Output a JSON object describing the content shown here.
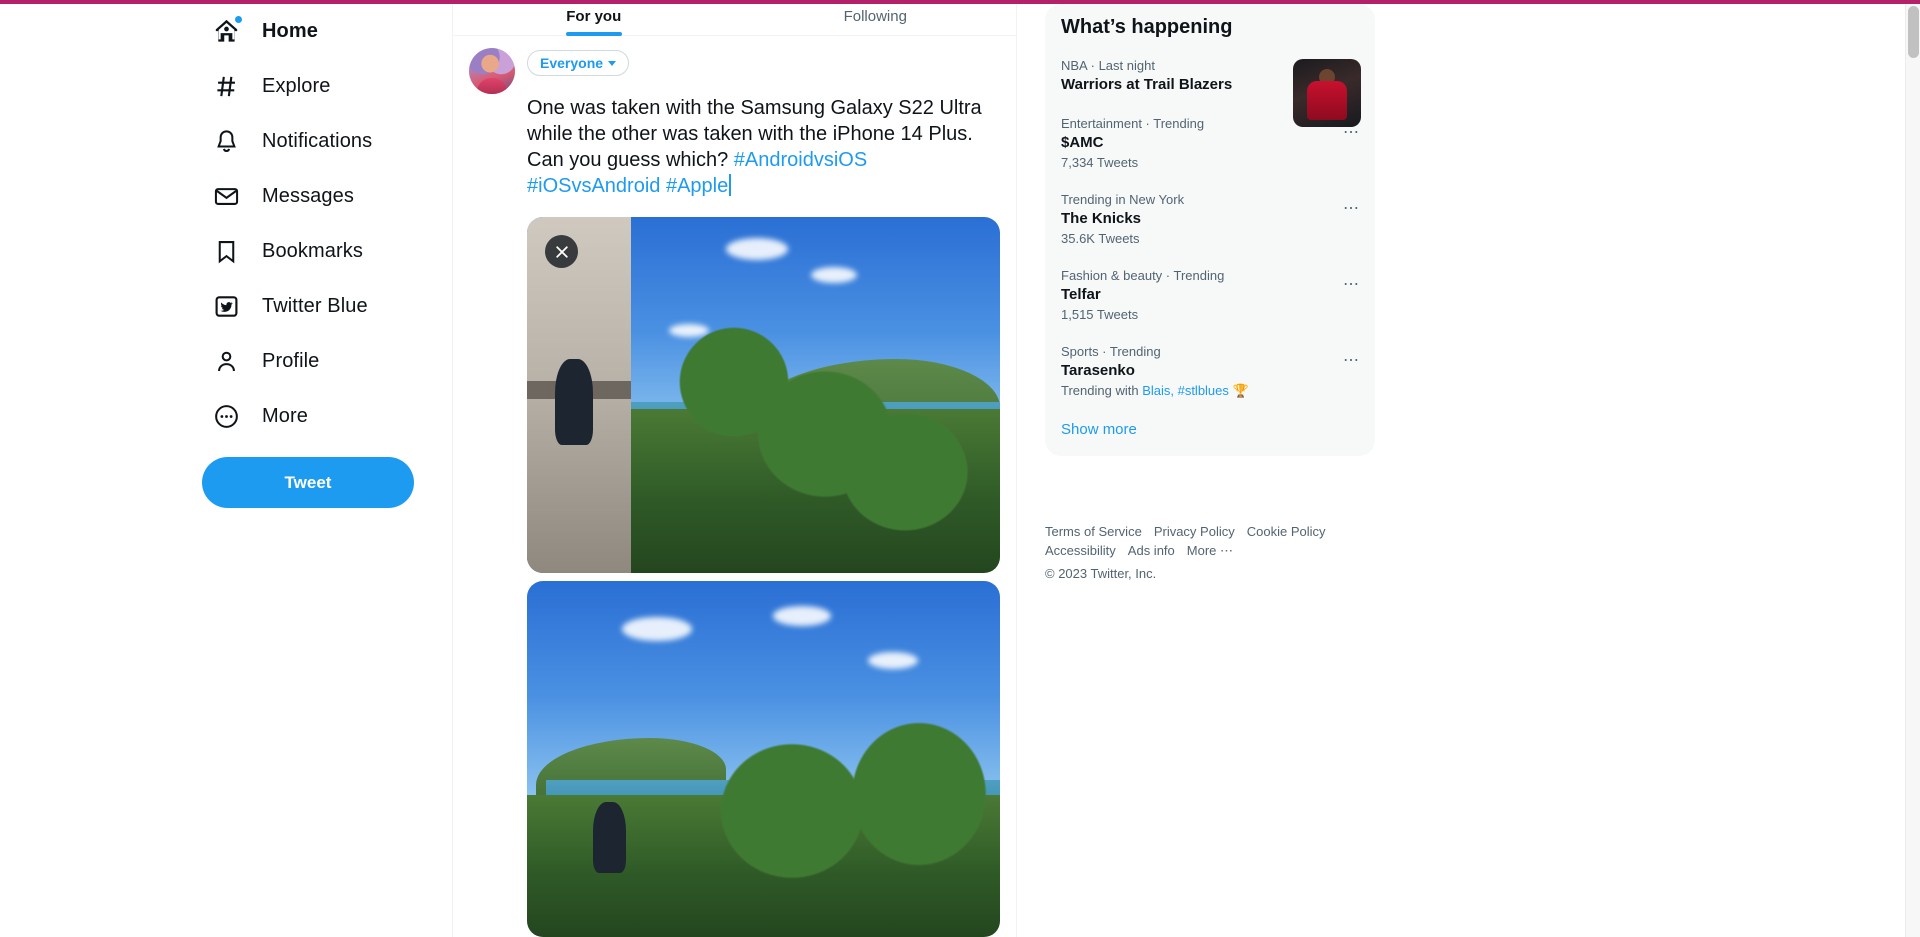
{
  "window": {
    "accent_magenta": "#b4216b",
    "brand_blue": "#1d9bf0"
  },
  "sidebar": {
    "items": [
      {
        "label": "Home",
        "icon": "home-icon",
        "active": true,
        "badge": true
      },
      {
        "label": "Explore",
        "icon": "hashtag-icon",
        "active": false,
        "badge": false
      },
      {
        "label": "Notifications",
        "icon": "bell-icon",
        "active": false,
        "badge": false
      },
      {
        "label": "Messages",
        "icon": "envelope-icon",
        "active": false,
        "badge": false
      },
      {
        "label": "Bookmarks",
        "icon": "bookmark-icon",
        "active": false,
        "badge": false
      },
      {
        "label": "Twitter Blue",
        "icon": "twitter-blue-icon",
        "active": false,
        "badge": false
      },
      {
        "label": "Profile",
        "icon": "person-icon",
        "active": false,
        "badge": false
      },
      {
        "label": "More",
        "icon": "more-circle-icon",
        "active": false,
        "badge": false
      }
    ],
    "tweet_button": "Tweet"
  },
  "timeline": {
    "tabs": [
      {
        "label": "For you",
        "active": true
      },
      {
        "label": "Following",
        "active": false
      }
    ]
  },
  "composer": {
    "audience": "Everyone",
    "text_plain": "One was taken with the Samsung Galaxy S22 Ultra while the other was taken with the iPhone 14 Plus. Can you guess which? ",
    "hashtags": [
      "#AndroidvsiOS",
      "#iOSvsAndroid",
      "#Apple"
    ],
    "remove_media_label": "Remove media",
    "media": [
      {
        "alt": "Tropical beach view from balcony with palm trees"
      },
      {
        "alt": "Tropical beach view with palm trees and blue sky"
      }
    ]
  },
  "whats_happening": {
    "title": "What’s happening",
    "trends": [
      {
        "category": "NBA · Last night",
        "name": "Warriors at Trail Blazers",
        "count": "",
        "has_thumb": true,
        "more": "⋯"
      },
      {
        "category": "Entertainment · Trending",
        "name": "$AMC",
        "count": "7,334 Tweets",
        "has_thumb": false,
        "more": "⋯"
      },
      {
        "category": "Trending in New York",
        "name": "The Knicks",
        "count": "35.6K Tweets",
        "has_thumb": false,
        "more": "⋯"
      },
      {
        "category": "Fashion & beauty · Trending",
        "name": "Telfar",
        "count": "1,515 Tweets",
        "has_thumb": false,
        "more": "⋯"
      },
      {
        "category": "Sports · Trending",
        "name": "Tarasenko",
        "count": "",
        "trending_with_prefix": "Trending with",
        "trending_with_links": "Blais, #stlblues",
        "trending_with_emoji": "🏆",
        "has_thumb": false,
        "more": "⋯"
      }
    ],
    "show_more": "Show more"
  },
  "footer": {
    "links_row1": [
      "Terms of Service",
      "Privacy Policy",
      "Cookie Policy"
    ],
    "links_row2": [
      "Accessibility",
      "Ads info",
      "More ⋯"
    ],
    "copyright": "© 2023 Twitter, Inc."
  }
}
